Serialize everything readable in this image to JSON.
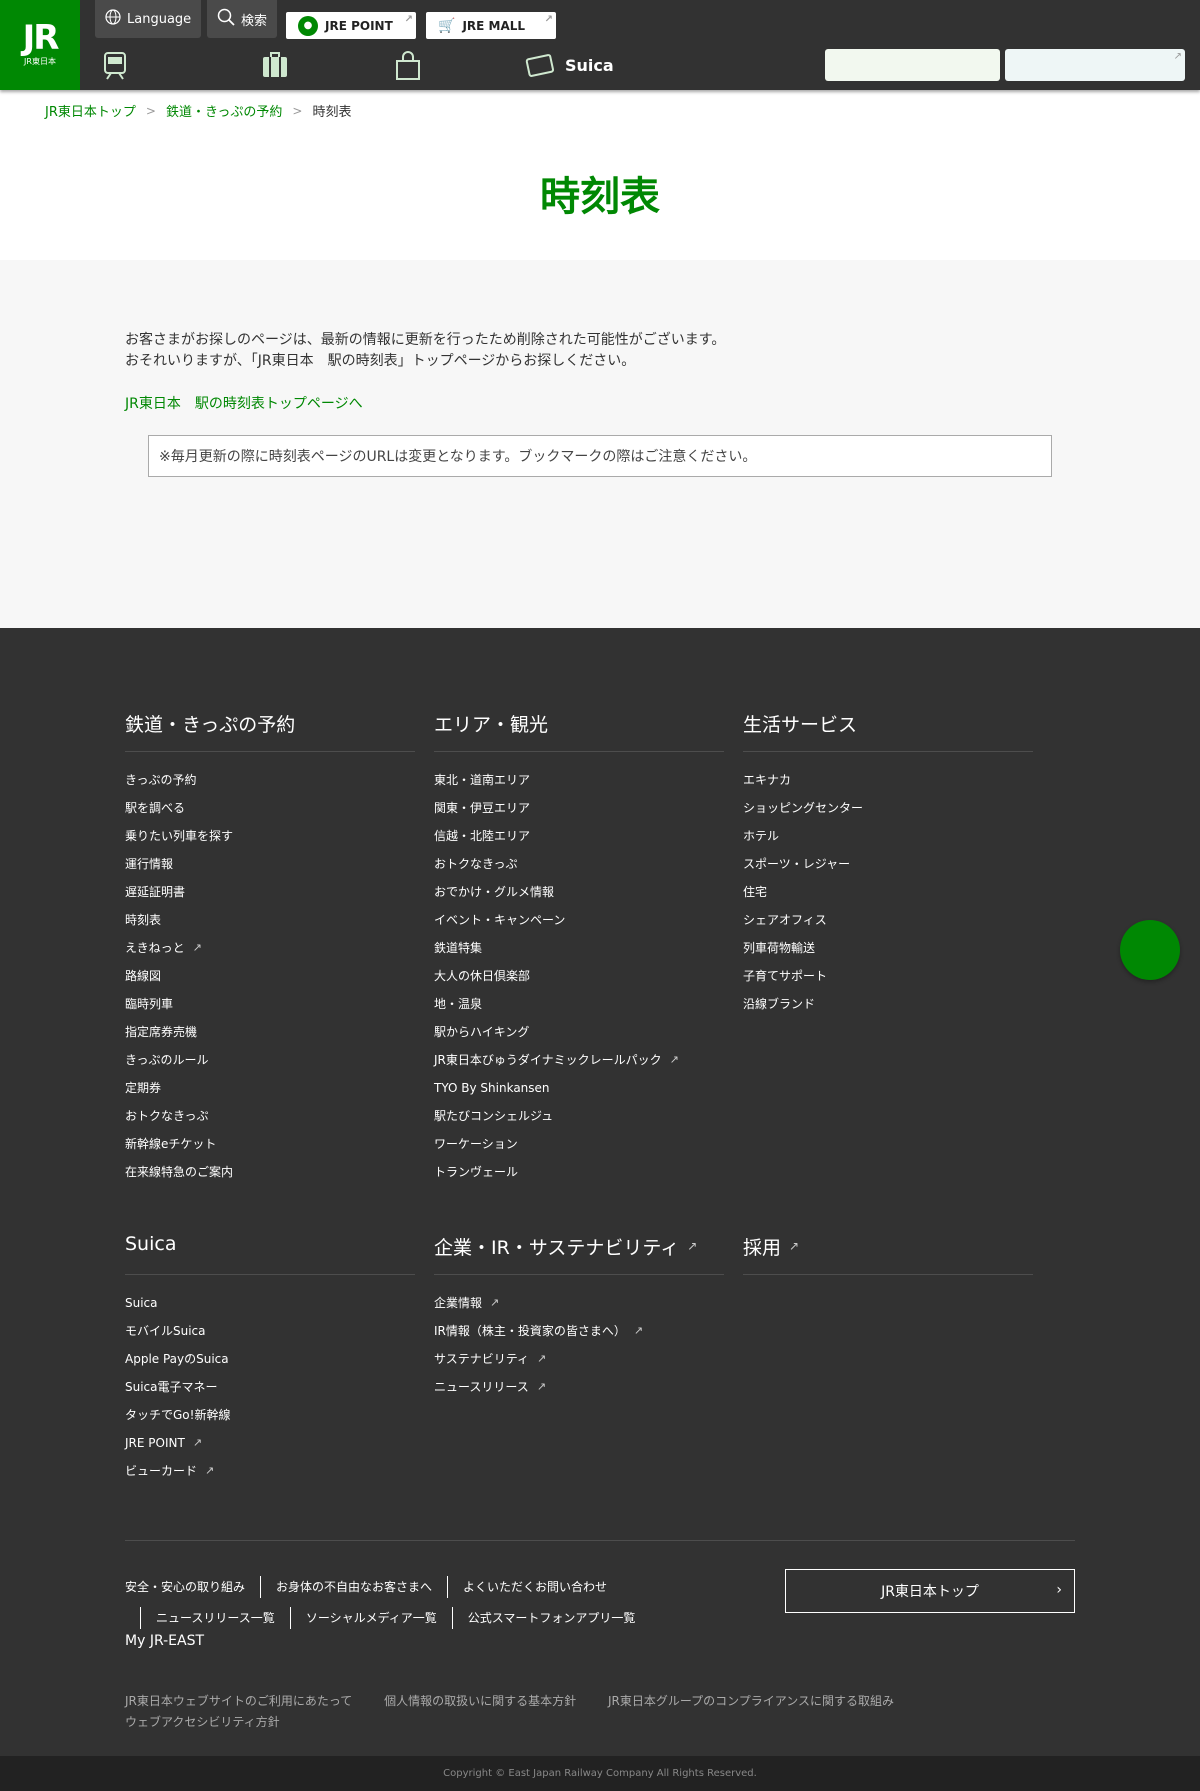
{
  "header": {
    "logo_text": "JR",
    "logo_sub": "JR東日本",
    "language_label": "Language",
    "search_label": "検索",
    "jre_point_label": "JRE POINT",
    "jre_mall_label": "JRE MALL",
    "top_right_text": "",
    "nav": [
      {
        "label": ""
      },
      {
        "label": ""
      },
      {
        "label": ""
      },
      {
        "label": "Suica"
      }
    ],
    "box1_label": "",
    "box2_label": ""
  },
  "breadcrumb": {
    "items": [
      "JR東日本トップ",
      "鉄道・きっぷの予約"
    ],
    "current": "時刻表"
  },
  "page_title": "時刻表",
  "main": {
    "line1": "お客さまがお探しのページは、最新の情報に更新を行ったため削除された可能性がございます。",
    "line2": "おそれいりますが、「JR東日本　駅の時刻表」トップページからお探しください。",
    "link": "JR東日本　駅の時刻表トップページへ",
    "notice": "※毎月更新の際に時刻表ページのURLは変更となります。ブックマークの際はご注意ください。"
  },
  "footer": {
    "columns": [
      {
        "title": "鉄道・きっぷの予約",
        "items": [
          "きっぷの予約",
          "駅を調べる",
          "乗りたい列車を探す",
          "運行情報",
          "遅延証明書",
          "時刻表",
          "えきねっと",
          "路線図",
          "臨時列車",
          "指定席券売機",
          "きっぷのルール",
          "定期券",
          "おトクなきっぷ",
          "新幹線eチケット",
          "在来線特急のご案内"
        ]
      },
      {
        "title": "エリア・観光",
        "items": [
          "東北・道南エリア",
          "関東・伊豆エリア",
          "信越・北陸エリア",
          "おトクなきっぷ",
          "おでかけ・グルメ情報",
          "イベント・キャンペーン",
          "鉄道特集",
          "大人の休日倶楽部",
          "地・温泉",
          "駅からハイキング",
          "JR東日本びゅうダイナミックレールパック",
          "TYO By Shinkansen",
          "駅たびコンシェルジュ",
          "ワーケーション",
          "トランヴェール"
        ]
      },
      {
        "title": "生活サービス",
        "items": [
          "エキナカ",
          "ショッピングセンター",
          "ホテル",
          "スポーツ・レジャー",
          "住宅",
          "シェアオフィス",
          "列車荷物輸送",
          "子育てサポート",
          "沿線ブランド"
        ]
      },
      {
        "title": "Suica",
        "items": [
          "Suica",
          "モバイルSuica",
          "Apple PayのSuica",
          "Suica電子マネー",
          "タッチでGo!新幹線",
          "JRE POINT",
          "ビューカード"
        ]
      },
      {
        "title": "企業・IR・サステナビリティ",
        "items": [
          "企業情報",
          "IR情報（株主・投資家の皆さまへ）",
          "サステナビリティ",
          "ニュースリリース"
        ]
      },
      {
        "title": "採用",
        "items": []
      }
    ],
    "links_row1": [
      "安全・安心の取り組み",
      "お身体の不自由なお客さまへ",
      "よくいただくお問い合わせ"
    ],
    "links_row2": [
      "ニュースリリース一覧",
      "ソーシャルメディア一覧",
      "公式スマートフォンアプリ一覧"
    ],
    "my_jr_east": "My JR-EAST",
    "top_button": "JR東日本トップ",
    "policy": [
      "JR東日本ウェブサイトのご利用にあたって",
      "個人情報の取扱いに関する基本方針",
      "JR東日本グループのコンプライアンスに関する取組み",
      "ウェブアクセシビリティ方針"
    ],
    "copyright": "Copyright © East Japan Railway Company All Rights Reserved."
  },
  "colors": {
    "brand_green": "#008803",
    "header_bg": "#323232",
    "footer_bg": "#323232",
    "main_bg": "#f7f7f7"
  }
}
